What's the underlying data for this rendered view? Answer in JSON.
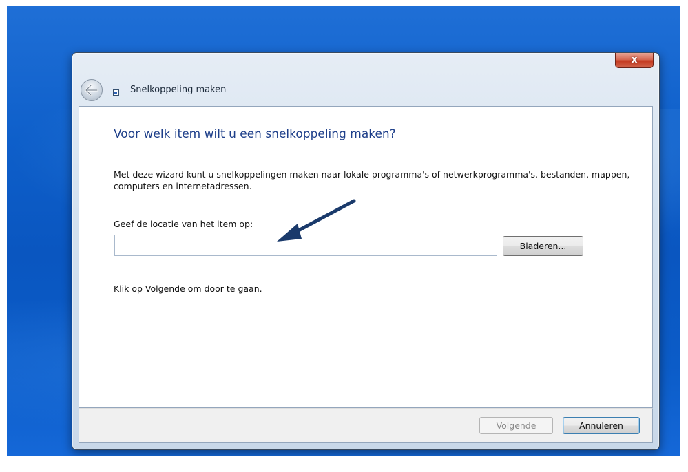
{
  "window": {
    "title": "Snelkoppeling maken",
    "close_glyph": "x"
  },
  "main": {
    "heading": "Voor welk item wilt u een snelkoppeling maken?",
    "description": "Met deze wizard kunt u snelkoppelingen maken naar lokale programma's of netwerkprogramma's, bestanden, mappen, computers en internetadressen.",
    "location_label": "Geef de locatie van het item op:",
    "location_value": "",
    "browse_label": "Bladeren...",
    "continue_text": "Klik op Volgende om door te gaan."
  },
  "footer": {
    "next_label": "Volgende",
    "cancel_label": "Annuleren"
  },
  "icons": {
    "back": "back-arrow-icon",
    "title": "shortcut-icon",
    "annotation": "annotation-arrow-icon"
  },
  "colors": {
    "heading": "#1e3f8a",
    "close_button": "#c4391f",
    "desktop": "#0e5fca",
    "annotation_arrow": "#1a3a6b"
  }
}
